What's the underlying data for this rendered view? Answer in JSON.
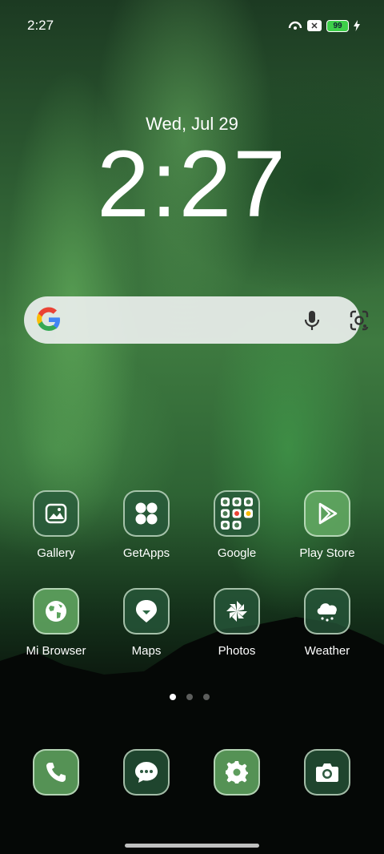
{
  "status_bar": {
    "time": "2:27",
    "battery_level": "99"
  },
  "lock_widget": {
    "date": "Wed, Jul 29",
    "time": "2:27"
  },
  "search_bar": {
    "placeholder": ""
  },
  "apps_row1": [
    {
      "label": "Gallery",
      "icon": "gallery-icon"
    },
    {
      "label": "GetApps",
      "icon": "getapps-icon"
    },
    {
      "label": "Google",
      "icon": "google-folder-icon"
    },
    {
      "label": "Play Store",
      "icon": "play-store-icon"
    }
  ],
  "apps_row2": [
    {
      "label": "Mi Browser",
      "icon": "globe-icon"
    },
    {
      "label": "Maps",
      "icon": "map-pin-icon"
    },
    {
      "label": "Photos",
      "icon": "pinwheel-icon"
    },
    {
      "label": "Weather",
      "icon": "cloud-icon"
    }
  ],
  "dock": [
    {
      "icon": "phone-icon"
    },
    {
      "icon": "message-icon"
    },
    {
      "icon": "settings-icon"
    },
    {
      "icon": "camera-icon"
    }
  ],
  "page_indicator": {
    "pages": 3,
    "current": 1
  }
}
